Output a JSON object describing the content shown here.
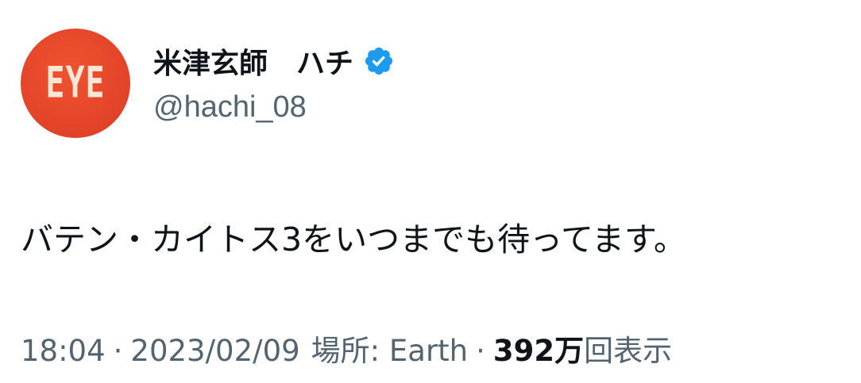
{
  "author": {
    "avatar_text": "EYE",
    "display_name": "米津玄師　ハチ",
    "handle": "@hachi_08",
    "verified": true,
    "verified_icon": "verified-badge-icon",
    "verified_color": "#1d9bf0",
    "avatar_color": "#e4452a"
  },
  "tweet": {
    "text": "バテン・カイトス3をいつまでも待ってます。"
  },
  "meta": {
    "time": "18:04",
    "sep1": "·",
    "date": "2023/02/09",
    "location": "場所: Earth",
    "sep2": "·",
    "views_count": "392万",
    "views_label": "回表示"
  },
  "colors": {
    "text_primary": "#0f1419",
    "text_secondary": "#536471"
  }
}
